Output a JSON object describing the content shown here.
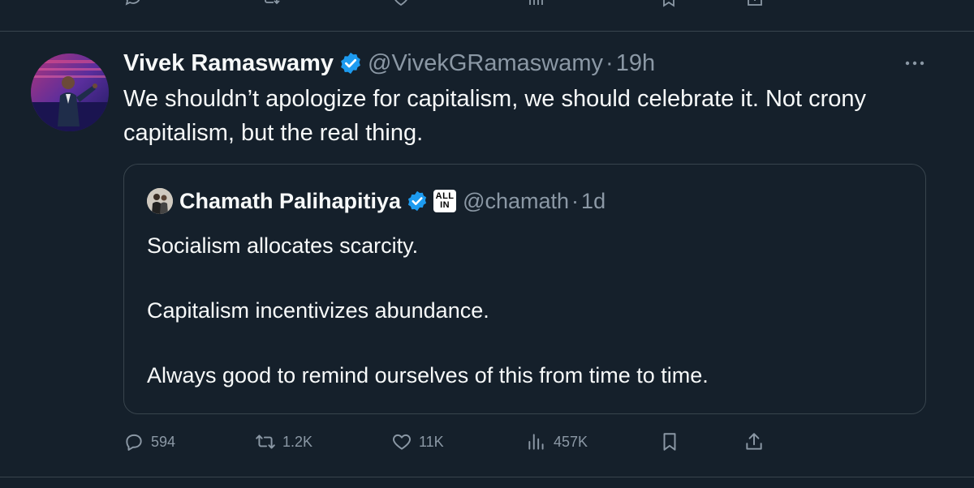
{
  "tweet": {
    "author_name": "Vivek Ramaswamy",
    "handle": "@VivekGRamaswamy",
    "separator": "·",
    "time": "19h",
    "text": "We shouldn’t apologize for capitalism, we should celebrate it. Not crony capitalism, but the real thing."
  },
  "quote": {
    "author_name": "Chamath Palihapitiya",
    "badge_line1": "ALL",
    "badge_line2": "IN",
    "handle": "@chamath",
    "separator": "·",
    "time": "1d",
    "paragraphs": [
      "Socialism allocates scarcity.",
      "Capitalism incentivizes abundance.",
      "Always good to remind ourselves of this from time to time."
    ]
  },
  "actions": {
    "replies": "594",
    "reposts": "1.2K",
    "likes": "11K",
    "views": "457K"
  },
  "icons": {
    "reply": "reply-icon",
    "repost": "repost-icon",
    "like": "like-icon",
    "views": "views-icon",
    "bookmark": "bookmark-icon",
    "share": "share-icon",
    "more": "more-icon",
    "verified": "verified-badge-icon"
  },
  "colors": {
    "background": "#15202b",
    "text": "#f7f9f9",
    "secondary": "#8b98a5",
    "border": "#38444d",
    "verified": "#1d9bf0"
  }
}
